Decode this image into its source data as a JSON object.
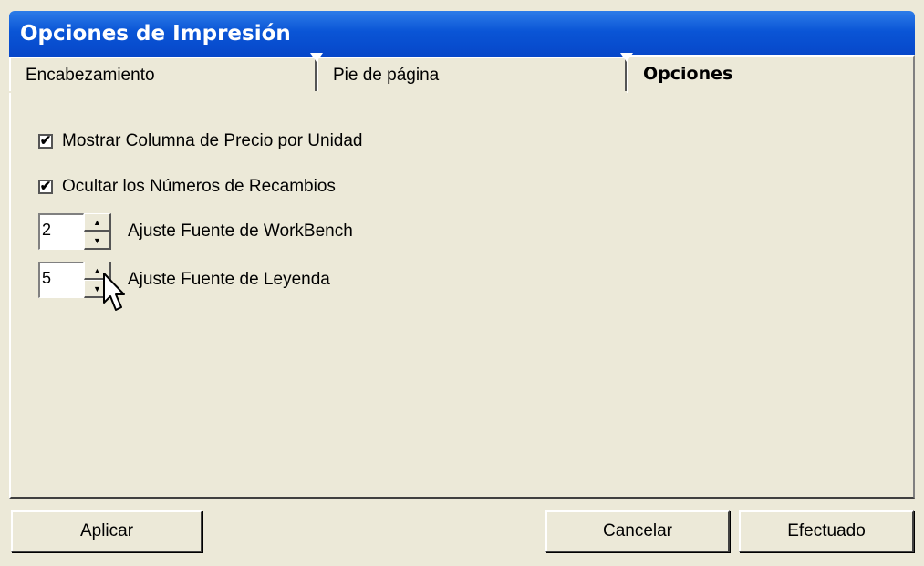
{
  "window": {
    "title": "Opciones de Impresión"
  },
  "tabs": [
    {
      "label": "Encabezamiento",
      "active": false
    },
    {
      "label": "Pie de página",
      "active": false
    },
    {
      "label": "Opciones",
      "active": true
    }
  ],
  "options": {
    "show_price_column": {
      "label": "Mostrar Columna de Precio por Unidad",
      "checked": true
    },
    "hide_part_numbers": {
      "label": "Ocultar los Números de Recambios",
      "checked": true
    },
    "workbench_font": {
      "label": "Ajuste Fuente de WorkBench",
      "value": "2"
    },
    "legend_font": {
      "label": "Ajuste Fuente de Leyenda",
      "value": "5"
    }
  },
  "buttons": {
    "apply": "Aplicar",
    "cancel": "Cancelar",
    "done": "Efectuado"
  },
  "icons": {
    "check": "✔",
    "up": "▲",
    "down": "▼"
  },
  "colors": {
    "titlebar": "#0a55d6",
    "face": "#ece9d8"
  }
}
